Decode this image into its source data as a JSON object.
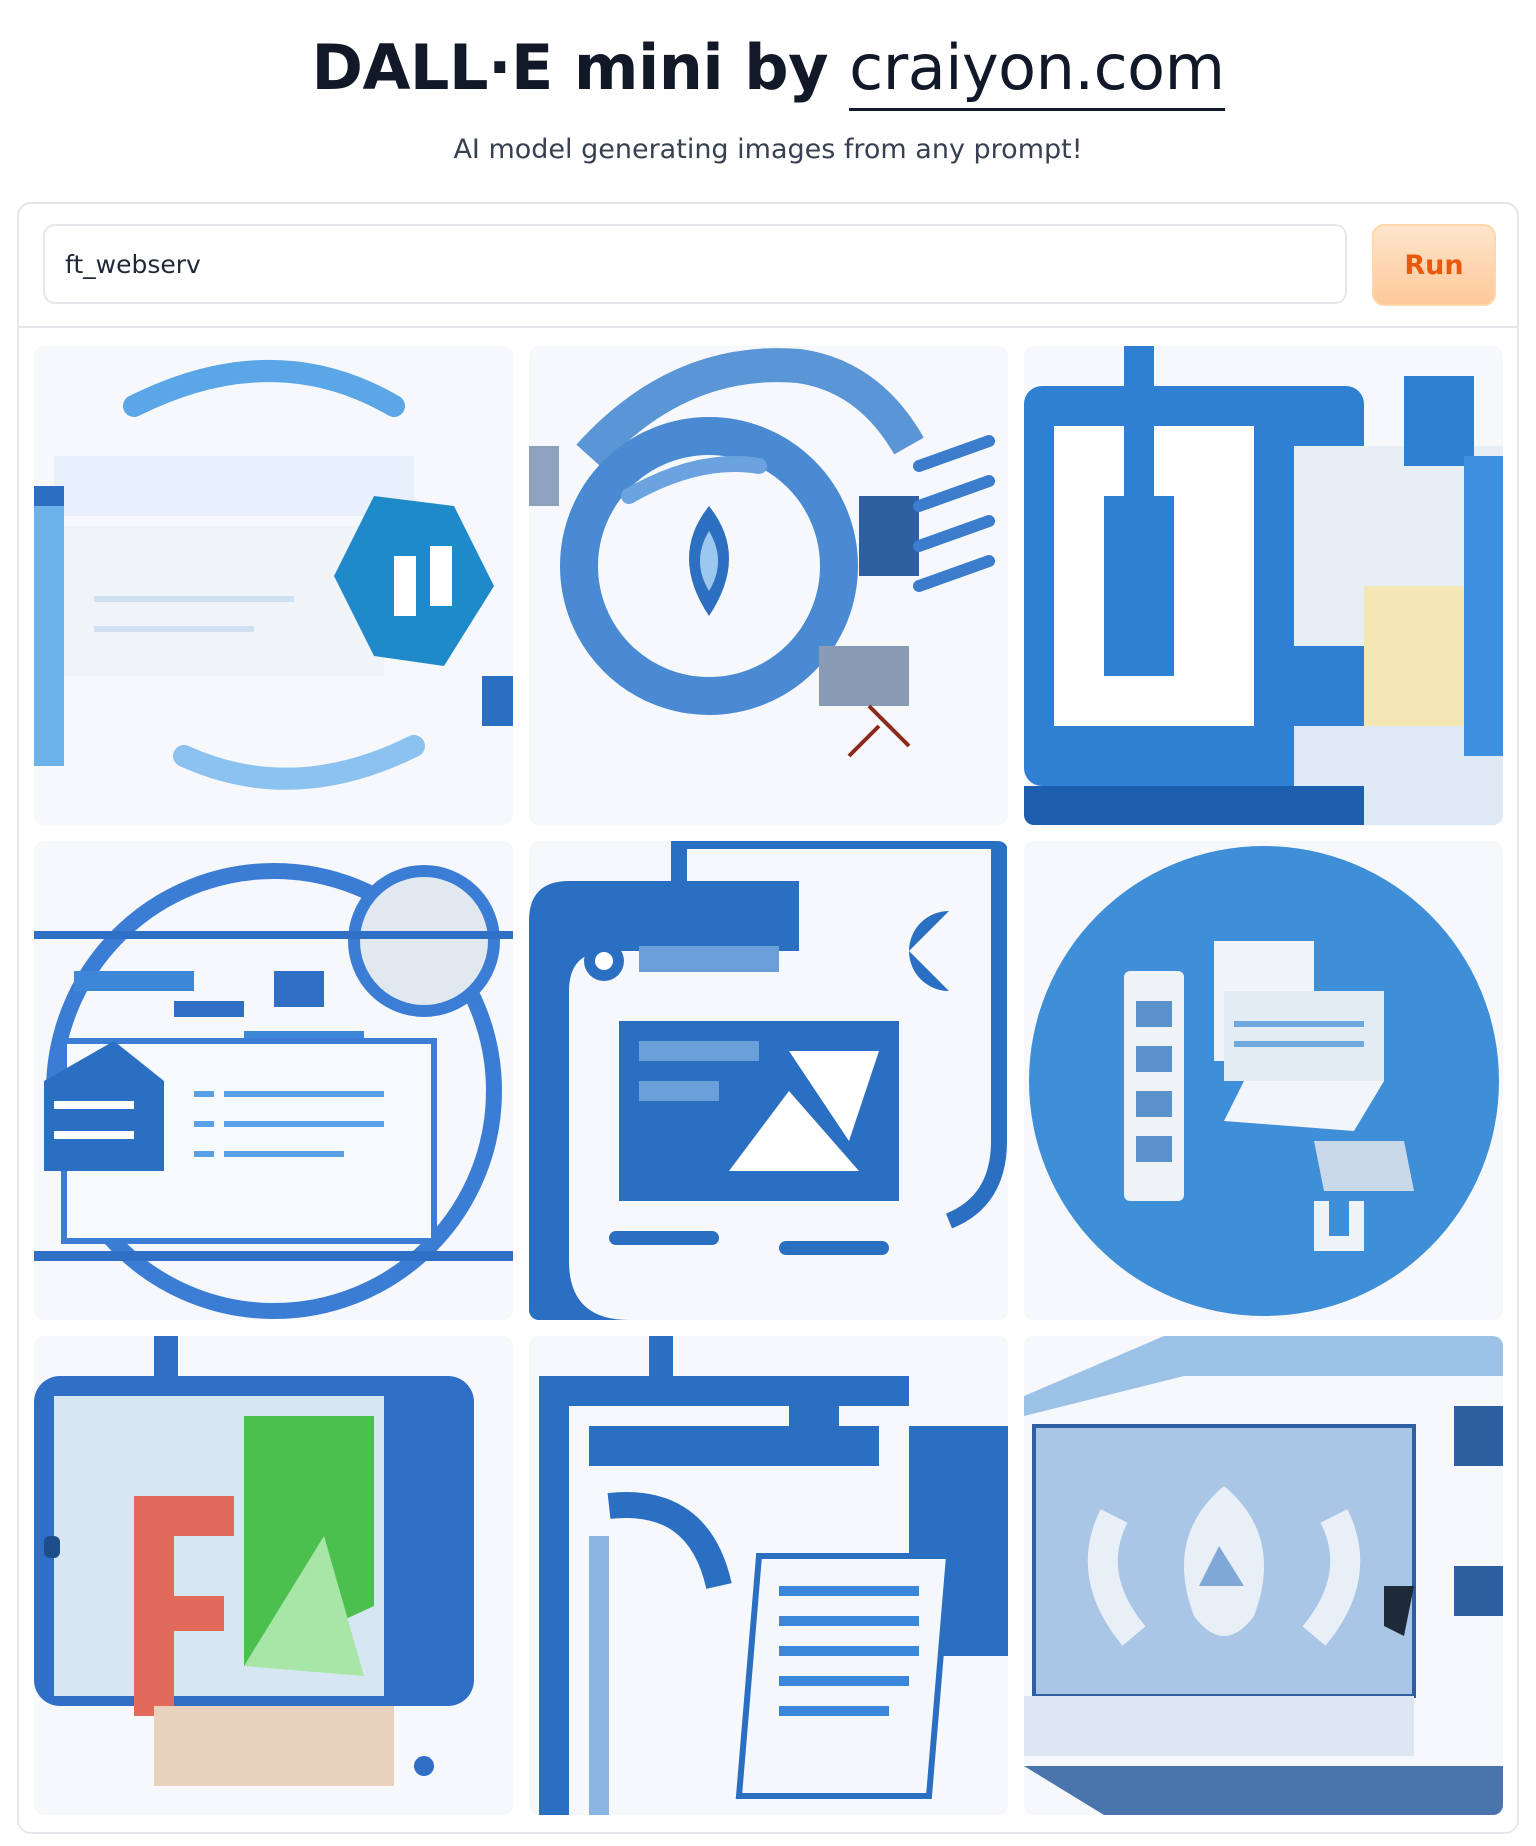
{
  "header": {
    "title_prefix": "DALL·E mini by ",
    "title_link": "craiyon.com",
    "subtitle": "AI model generating images from any prompt!"
  },
  "prompt": {
    "value": "ft_webserv"
  },
  "run_button": {
    "label": "Run"
  },
  "colors": {
    "accent": "#ea580c",
    "button_bg": "#fdd8b4",
    "primary_blue": "#2f7fd3",
    "dark_blue": "#1d5fae",
    "light_blue": "#9cc8f0"
  },
  "images": {
    "count": 9,
    "rows": 3,
    "columns": 3
  }
}
